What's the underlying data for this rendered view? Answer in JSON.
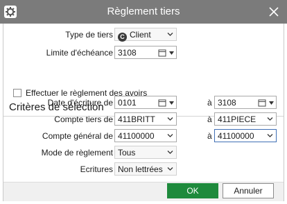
{
  "window": {
    "title": "Règlement tiers",
    "app_icon": "gear-icon",
    "close_icon": "close-icon"
  },
  "form": {
    "type_tiers": {
      "label": "Type de tiers",
      "value": "Client",
      "badge": "C"
    },
    "limite_echeance": {
      "label": "Limite d'échéance",
      "value": "3108"
    },
    "effectuer_avoirs": {
      "label": "Effectuer le règlement des avoirs",
      "checked": false
    }
  },
  "criteria": {
    "title": "Critères de sélection",
    "date_ecriture": {
      "label": "Date d'écriture de",
      "from": "0101",
      "to_label": "à",
      "to": "3108"
    },
    "compte_tiers": {
      "label": "Compte tiers de",
      "from": "411BRITT",
      "to_label": "à",
      "to": "411PIECE"
    },
    "compte_general": {
      "label": "Compte général de",
      "from": "41100000",
      "to_label": "à",
      "to": "41100000"
    },
    "mode_reglement": {
      "label": "Mode de règlement",
      "value": "Tous"
    },
    "ecritures": {
      "label": "Ecritures",
      "value": "Non lettrées"
    }
  },
  "buttons": {
    "ok": "OK",
    "cancel": "Annuler"
  },
  "colors": {
    "titlebar": "#7b7b7b",
    "ok_button": "#1e8a3c",
    "focus_border": "#3f6fb5"
  }
}
